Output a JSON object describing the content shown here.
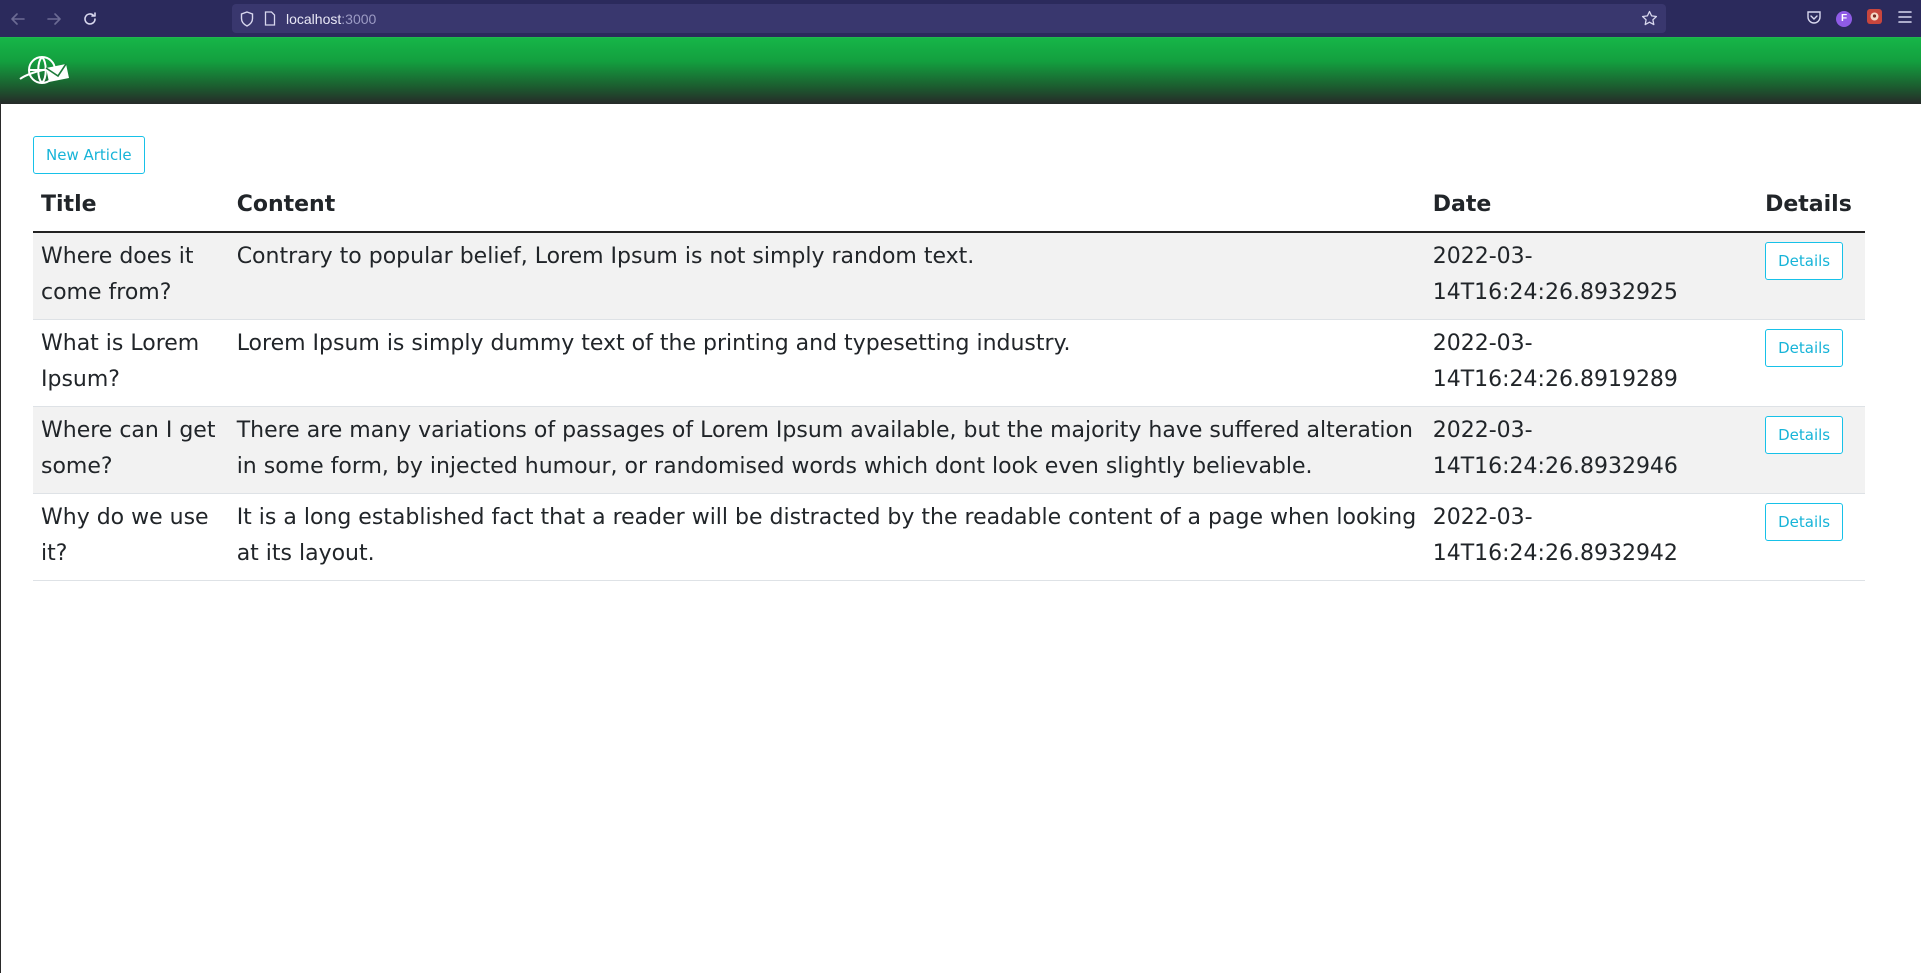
{
  "browser": {
    "url_host": "localhost",
    "url_port": ":3000",
    "profile_initial": "F",
    "icons": [
      "back-icon",
      "forward-icon",
      "reload-icon",
      "shield-icon",
      "page-icon",
      "star-icon",
      "pocket-icon",
      "profile-icon",
      "extension-icon",
      "menu-icon"
    ]
  },
  "header": {
    "logo_icon": "globe-envelope-logo",
    "gradient_colors": [
      "#16b548",
      "#262a29"
    ]
  },
  "main": {
    "new_article_label": "New Article",
    "table": {
      "columns": [
        "Title",
        "Content",
        "Date",
        "Details"
      ],
      "rows": [
        {
          "title": "Where does it come from?",
          "content": "Contrary to popular belief, Lorem Ipsum is not simply random text.",
          "date": "2022-03-14T16:24:26.8932925",
          "details_label": "Details"
        },
        {
          "title": "What is Lorem Ipsum?",
          "content": "Lorem Ipsum is simply dummy text of the printing and typesetting industry.",
          "date": "2022-03-14T16:24:26.8919289",
          "details_label": "Details"
        },
        {
          "title": "Where can I get some?",
          "content": "There are many variations of passages of Lorem Ipsum available, but the majority have suffered alteration in some form, by injected humour, or randomised words which dont look even slightly believable.",
          "date": "2022-03-14T16:24:26.8932946",
          "details_label": "Details"
        },
        {
          "title": "Why do we use it?",
          "content": "It is a long established fact that a reader will be distracted by the readable content of a page when looking at its layout.",
          "date": "2022-03-14T16:24:26.8932942",
          "details_label": "Details"
        }
      ]
    }
  },
  "colors": {
    "accent": "#17c1e8",
    "chrome": "#2b2a5c"
  }
}
